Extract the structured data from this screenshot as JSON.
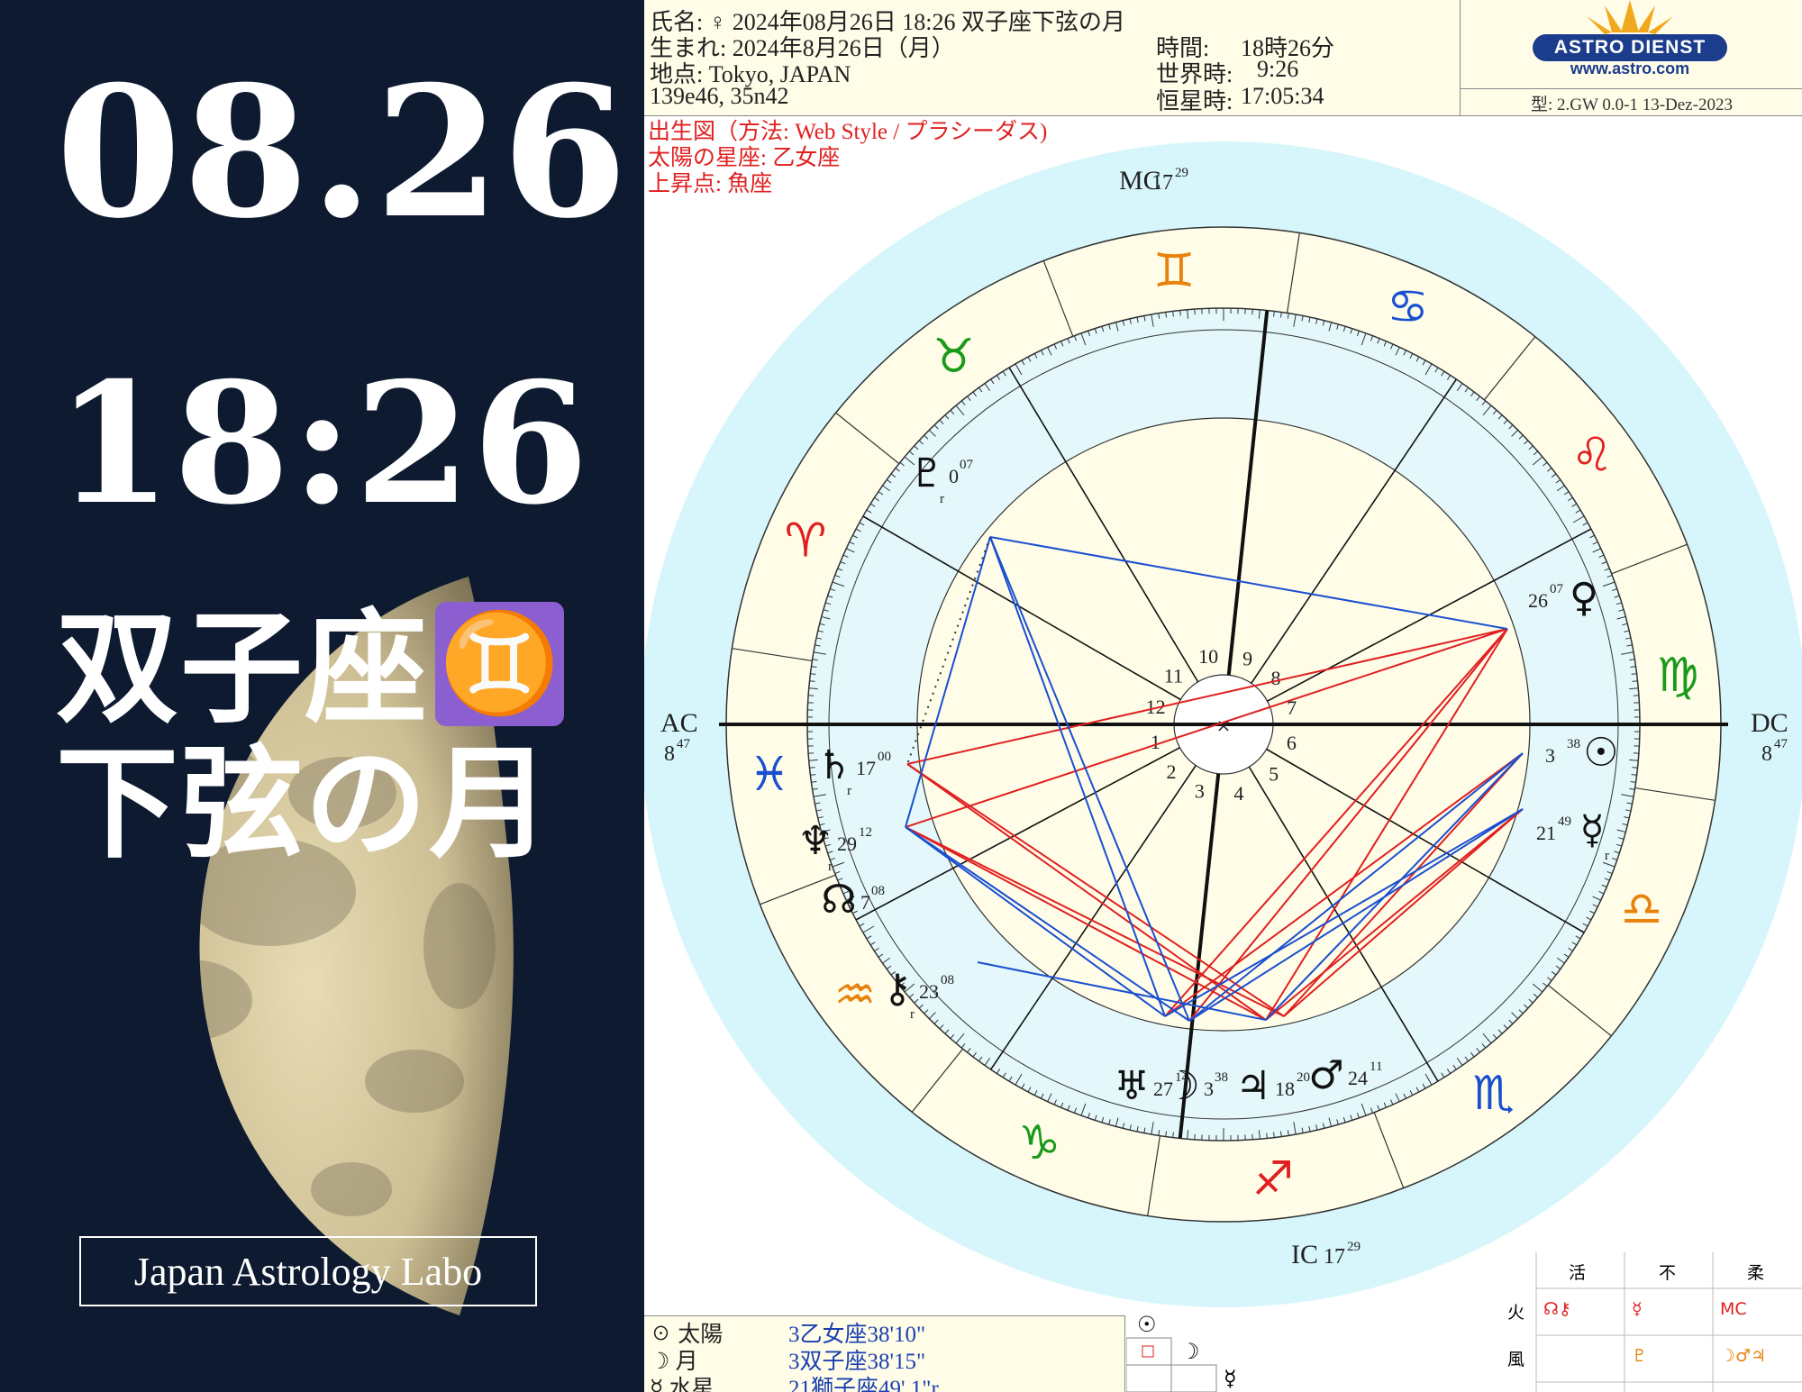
{
  "left": {
    "date": "08.26",
    "time": "18:26",
    "sign_line": "双子座",
    "sign_glyph": "♊",
    "phase_line": "下弦の月",
    "brand": "Japan Astrology Labo"
  },
  "header": {
    "name_line": "氏名: ♀ 2024年08月26日 18:26 双子座下弦の月",
    "born_line": "生まれ: 2024年8月26日（月）",
    "place_line": "地点:  Tokyo, JAPAN",
    "coords_line": "139e46, 35n42",
    "time_label": "時間:",
    "time_value": "18時26分",
    "ut_label": "世界時:",
    "ut_value": "9:26",
    "sidereal_label": "恒星時:",
    "sidereal_value": "17:05:34",
    "logo_left": "ASTRO",
    "logo_right": "DIENST",
    "logo_url": "www.astro.com",
    "version": "型: 2.GW   0.0-1   13-Dez-2023"
  },
  "chart_info": {
    "line1": "出生図（方法: Web Style / プラシーダス)",
    "line2": "太陽の星座: 乙女座",
    "line3": "上昇点: 魚座"
  },
  "angles": {
    "mc_label": "MC",
    "mc_deg": "17",
    "mc_min": "29",
    "ic_label": "IC",
    "ic_deg": "17",
    "ic_min": "29",
    "ac_label": "AC",
    "ac_deg": "8",
    "ac_min": "47",
    "dc_label": "DC",
    "dc_deg": "8",
    "dc_min": "47"
  },
  "house_numbers": [
    "1",
    "2",
    "3",
    "4",
    "5",
    "6",
    "7",
    "8",
    "9",
    "10",
    "11",
    "12"
  ],
  "sign_glyphs": [
    "♓",
    "♒",
    "♑",
    "♐",
    "♏",
    "♎",
    "♍",
    "♌",
    "♋",
    "♊",
    "♉",
    "♈"
  ],
  "colors": {
    "fire": "#e02020",
    "earth": "#1a9a1a",
    "air": "#e8820c",
    "water": "#1a4fd0",
    "ring_outer": "#d6f6fb",
    "ring_sign": "#fffde8",
    "aspect_red": "#e02020",
    "aspect_blue": "#1a4fd0"
  },
  "planets": [
    {
      "glyph": "♇",
      "label": "r",
      "deg": "0",
      "min": "07"
    },
    {
      "glyph": "♀",
      "label": "",
      "deg": "26",
      "min": "07"
    },
    {
      "glyph": "☉",
      "label": "",
      "deg": "3",
      "min": "38"
    },
    {
      "glyph": "☿",
      "label": "r",
      "deg": "21",
      "min": "49"
    },
    {
      "glyph": "♄",
      "label": "r",
      "deg": "17",
      "min": "00"
    },
    {
      "glyph": "♆",
      "label": "r",
      "deg": "29",
      "min": "12"
    },
    {
      "glyph": "☊",
      "label": "",
      "deg": "7",
      "min": "08"
    },
    {
      "glyph": "⚷",
      "label": "r",
      "deg": "23",
      "min": "08"
    },
    {
      "glyph": "♅",
      "label": "",
      "deg": "27",
      "min": "14"
    },
    {
      "glyph": "☽",
      "label": "",
      "deg": "3",
      "min": "38"
    },
    {
      "glyph": "♃",
      "label": "",
      "deg": "18",
      "min": "20"
    },
    {
      "glyph": "♂",
      "label": "",
      "deg": "24",
      "min": "11"
    }
  ],
  "planet_table": [
    {
      "name": "☉ 太陽",
      "value": "3乙女座38'10\""
    },
    {
      "name": "☽ 月",
      "value": "3双子座38'15\""
    },
    {
      "name": "☿ 水星",
      "value": "21獅子座49' 1\"r"
    }
  ],
  "aspect_grid": [
    "☉",
    "☽",
    "☿"
  ],
  "element_table": {
    "cols": [
      "活",
      "不",
      "柔"
    ],
    "rows": [
      {
        "label": "火",
        "cells": [
          "☊⚷",
          "☿",
          "MC"
        ]
      },
      {
        "label": "風",
        "cells": [
          "",
          "♇",
          "☽♂♃"
        ]
      }
    ]
  }
}
